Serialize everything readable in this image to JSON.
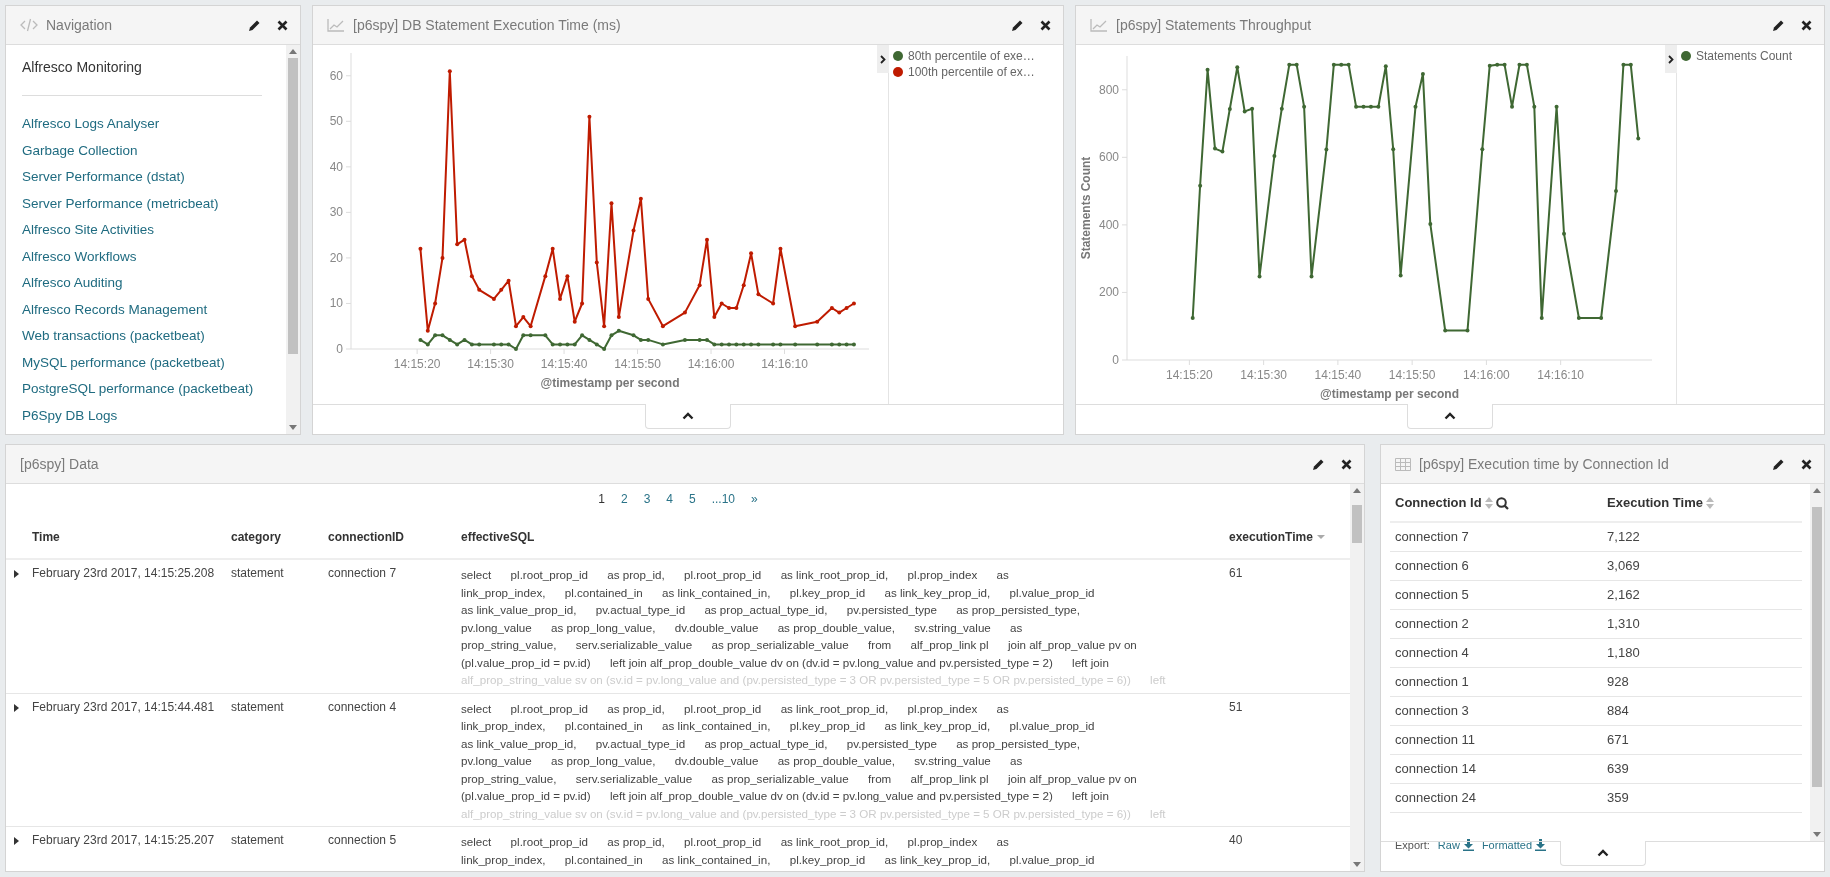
{
  "navigation": {
    "title": "Navigation",
    "heading": "Alfresco Monitoring",
    "links": [
      "Alfresco Logs Analyser",
      "Garbage Collection",
      "Server Performance (dstat)",
      "Server Performance (metricbeat)",
      "Alfresco Site Activities",
      "Alfresco Workflows",
      "Alfresco Auditing",
      "Alfresco Records Management",
      "Web transactions (packetbeat)",
      "MySQL performance (packetbeat)",
      "PostgreSQL performance (packetbeat)",
      "P6Spy DB Logs"
    ]
  },
  "execution_chart": {
    "title": "[p6spy] DB Statement Execution Time (ms)",
    "chart_data": {
      "type": "line",
      "xlabel": "@timestamp per second",
      "categories": [
        "14:15:20",
        null,
        null,
        null,
        null,
        null,
        null,
        null,
        null,
        null,
        "14:15:30",
        null,
        null,
        null,
        null,
        null,
        null,
        null,
        null,
        null,
        "14:15:40",
        null,
        null,
        null,
        null,
        null,
        null,
        null,
        null,
        null,
        "14:15:50",
        null,
        null,
        null,
        null,
        null,
        null,
        null,
        null,
        null,
        "14:16:00",
        null,
        null,
        null,
        null,
        null,
        null,
        null,
        null,
        null,
        "14:16:10",
        null,
        null,
        null,
        null,
        null,
        null,
        null,
        null,
        null
      ],
      "series": [
        {
          "name": "80th percentile of exe…",
          "color": "#3f6833",
          "values": [
            2,
            1,
            3,
            3,
            2,
            1,
            2,
            1,
            1,
            null,
            1,
            1,
            1,
            0,
            3,
            3,
            null,
            3,
            1,
            1,
            1,
            1,
            3,
            2,
            1,
            0,
            3,
            4,
            null,
            3,
            2,
            2,
            null,
            1,
            null,
            null,
            2,
            null,
            2,
            2,
            1,
            1,
            1,
            1,
            1,
            1,
            1,
            null,
            1,
            1,
            null,
            1,
            null,
            null,
            1,
            null,
            1,
            1,
            1,
            1
          ]
        },
        {
          "name": "100th percentile of ex…",
          "color": "#bf1b00",
          "values": [
            22,
            4,
            10,
            20,
            61,
            23,
            24,
            16,
            13,
            null,
            11,
            13,
            15,
            5,
            7,
            5,
            null,
            16,
            22,
            11,
            16,
            6,
            10,
            51,
            19,
            5,
            32,
            7,
            null,
            26,
            33,
            11,
            null,
            5,
            null,
            null,
            8,
            null,
            14,
            24,
            7,
            10,
            9,
            9,
            14,
            21,
            12,
            null,
            10,
            22,
            null,
            5,
            null,
            null,
            6,
            null,
            9,
            8,
            9,
            10
          ]
        }
      ],
      "ylim": [
        0,
        65
      ],
      "yticks": [
        0,
        10,
        20,
        30,
        40,
        50,
        60
      ]
    }
  },
  "throughput_chart": {
    "title": "[p6spy] Statements Throughput",
    "chart_data": {
      "type": "line",
      "xlabel": "@timestamp per second",
      "ylabel": "Statements Count",
      "categories": [
        "14:15:20",
        null,
        null,
        null,
        null,
        null,
        null,
        null,
        null,
        null,
        "14:15:30",
        null,
        null,
        null,
        null,
        null,
        null,
        null,
        null,
        null,
        "14:15:40",
        null,
        null,
        null,
        null,
        null,
        null,
        null,
        null,
        null,
        "14:15:50",
        null,
        null,
        null,
        null,
        null,
        null,
        null,
        null,
        null,
        "14:16:00",
        null,
        null,
        null,
        null,
        null,
        null,
        null,
        null,
        null,
        "14:16:10",
        null,
        null,
        null,
        null,
        null,
        null,
        null,
        null,
        null,
        null
      ],
      "series": [
        {
          "name": "Statements Count",
          "color": "#3f6833",
          "values": [
            124,
            516,
            859,
            626,
            617,
            743,
            867,
            736,
            744,
            247,
            null,
            604,
            744,
            874,
            874,
            750,
            247,
            null,
            623,
            874,
            874,
            874,
            750,
            750,
            750,
            750,
            870,
            624,
            250,
            null,
            750,
            847,
            403,
            null,
            87,
            null,
            null,
            87,
            null,
            624,
            871,
            874,
            874,
            750,
            874,
            874,
            750,
            124,
            null,
            750,
            374,
            null,
            124,
            null,
            null,
            124,
            null,
            500,
            874,
            874,
            656
          ]
        }
      ],
      "ylim": [
        0,
        900
      ],
      "yticks": [
        0,
        200,
        400,
        600,
        800
      ]
    }
  },
  "data_table": {
    "title": "[p6spy] Data",
    "pages": [
      {
        "label": "1",
        "selected": true
      },
      {
        "label": "2",
        "selected": false
      },
      {
        "label": "3",
        "selected": false
      },
      {
        "label": "4",
        "selected": false
      },
      {
        "label": "5",
        "selected": false
      },
      {
        "label": "...10",
        "selected": false
      },
      {
        "label": "»",
        "selected": false
      }
    ],
    "columns": [
      {
        "label": "Time",
        "sorted": false
      },
      {
        "label": "category",
        "sorted": false
      },
      {
        "label": "connectionID",
        "sorted": false
      },
      {
        "label": "effectiveSQL",
        "sorted": false
      },
      {
        "label": "executionTime",
        "sorted": true
      }
    ],
    "rows": [
      {
        "time": "February 23rd 2017, 14:15:25.208",
        "category": "statement",
        "connection": "connection 7",
        "execution_time": "61",
        "sql_lines": [
          "select      pl.root_prop_id      as prop_id,      pl.root_prop_id      as link_root_prop_id,      pl.prop_index      as",
          "link_prop_index,      pl.contained_in      as link_contained_in,      pl.key_prop_id      as link_key_prop_id,      pl.value_prop_id",
          "as link_value_prop_id,      pv.actual_type_id      as prop_actual_type_id,      pv.persisted_type      as prop_persisted_type,",
          "pv.long_value      as prop_long_value,      dv.double_value      as prop_double_value,      sv.string_value      as",
          "prop_string_value,      serv.serializable_value      as prop_serializable_value      from      alf_prop_link pl      join alf_prop_value pv on",
          "(pl.value_prop_id = pv.id)      left join alf_prop_double_value dv on (dv.id = pv.long_value and pv.persisted_type = 2)      left join"
        ],
        "sql_faded": "alf_prop_string_value sv on (sv.id = pv.long_value and (pv.persisted_type = 3 OR pv.persisted_type = 5 OR pv.persisted_type = 6))      left"
      },
      {
        "time": "February 23rd 2017, 14:15:44.481",
        "category": "statement",
        "connection": "connection 4",
        "execution_time": "51",
        "sql_lines": [
          "select      pl.root_prop_id      as prop_id,      pl.root_prop_id      as link_root_prop_id,      pl.prop_index      as",
          "link_prop_index,      pl.contained_in      as link_contained_in,      pl.key_prop_id      as link_key_prop_id,      pl.value_prop_id",
          "as link_value_prop_id,      pv.actual_type_id      as prop_actual_type_id,      pv.persisted_type      as prop_persisted_type,",
          "pv.long_value      as prop_long_value,      dv.double_value      as prop_double_value,      sv.string_value      as",
          "prop_string_value,      serv.serializable_value      as prop_serializable_value      from      alf_prop_link pl      join alf_prop_value pv on",
          "(pl.value_prop_id = pv.id)      left join alf_prop_double_value dv on (dv.id = pv.long_value and pv.persisted_type = 2)      left join"
        ],
        "sql_faded": "alf_prop_string_value sv on (sv.id = pv.long_value and (pv.persisted_type = 3 OR pv.persisted_type = 5 OR pv.persisted_type = 6))      left"
      },
      {
        "time": "February 23rd 2017, 14:15:25.207",
        "category": "statement",
        "connection": "connection 5",
        "execution_time": "40",
        "sql_lines": [
          "select      pl.root_prop_id      as prop_id,      pl.root_prop_id      as link_root_prop_id,      pl.prop_index      as",
          "link_prop_index,      pl.contained_in      as link_contained_in,      pl.key_prop_id      as link_key_prop_id,      pl.value_prop_id"
        ]
      }
    ]
  },
  "connection_table": {
    "title": "[p6spy] Execution time by Connection Id",
    "columns": [
      {
        "label": "Connection Id",
        "searchable": true
      },
      {
        "label": "Execution Time",
        "searchable": false
      }
    ],
    "rows": [
      [
        "connection 7",
        "7,122"
      ],
      [
        "connection 6",
        "3,069"
      ],
      [
        "connection 5",
        "2,162"
      ],
      [
        "connection 2",
        "1,310"
      ],
      [
        "connection 4",
        "1,180"
      ],
      [
        "connection 1",
        "928"
      ],
      [
        "connection 3",
        "884"
      ],
      [
        "connection 11",
        "671"
      ],
      [
        "connection 14",
        "639"
      ],
      [
        "connection 24",
        "359"
      ]
    ],
    "export": {
      "label": "Export:",
      "links": [
        "Raw",
        "Formatted"
      ]
    }
  }
}
